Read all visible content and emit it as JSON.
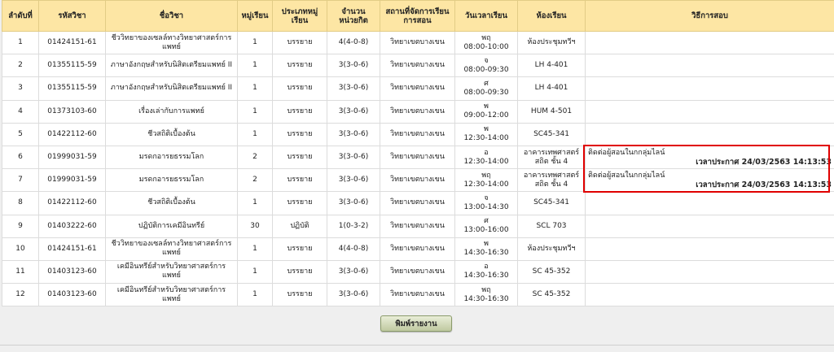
{
  "table": {
    "headers": [
      "ลำดับที่",
      "รหัสวิชา",
      "ชื่อวิชา",
      "หมู่เรียน",
      "ประเภทหมู่เรียน",
      "จำนวนหน่วยกิต",
      "สถานที่จัดการเรียนการสอน",
      "วันเวลาเรียน",
      "ห้องเรียน",
      "วิธีการสอบ"
    ],
    "rows": [
      {
        "no": "1",
        "code": "01424151-61",
        "name": "ชีววิทยาของเซลล์ทางวิทยาศาสตร์การแพทย์",
        "section": "1",
        "type": "บรรยาย",
        "credits": "4(4-0-8)",
        "campus": "วิทยาเขตบางเขน",
        "day": "พฤ",
        "time": "08:00-10:00",
        "room": "ห้องประชุมทวีฯ",
        "exam_note": "",
        "exam_time": ""
      },
      {
        "no": "2",
        "code": "01355115-59",
        "name": "ภาษาอังกฤษสำหรับนิสิตเตรียมแพทย์ II",
        "section": "1",
        "type": "บรรยาย",
        "credits": "3(3-0-6)",
        "campus": "วิทยาเขตบางเขน",
        "day": "จ",
        "time": "08:00-09:30",
        "room": "LH 4-401",
        "exam_note": "",
        "exam_time": ""
      },
      {
        "no": "3",
        "code": "01355115-59",
        "name": "ภาษาอังกฤษสำหรับนิสิตเตรียมแพทย์ II",
        "section": "1",
        "type": "บรรยาย",
        "credits": "3(3-0-6)",
        "campus": "วิทยาเขตบางเขน",
        "day": "ศ",
        "time": "08:00-09:30",
        "room": "LH 4-401",
        "exam_note": "",
        "exam_time": ""
      },
      {
        "no": "4",
        "code": "01373103-60",
        "name": "เรื่องเล่ากับการแพทย์",
        "section": "1",
        "type": "บรรยาย",
        "credits": "3(3-0-6)",
        "campus": "วิทยาเขตบางเขน",
        "day": "พ",
        "time": "09:00-12:00",
        "room": "HUM 4-501",
        "exam_note": "",
        "exam_time": ""
      },
      {
        "no": "5",
        "code": "01422112-60",
        "name": "ชีวสถิติเบื้องต้น",
        "section": "1",
        "type": "บรรยาย",
        "credits": "3(3-0-6)",
        "campus": "วิทยาเขตบางเขน",
        "day": "พ",
        "time": "12:30-14:00",
        "room": "SC45-341",
        "exam_note": "",
        "exam_time": ""
      },
      {
        "no": "6",
        "code": "01999031-59",
        "name": "มรดกอารยธรรมโลก",
        "section": "2",
        "type": "บรรยาย",
        "credits": "3(3-0-6)",
        "campus": "วิทยาเขตบางเขน",
        "day": "อ",
        "time": "12:30-14:00",
        "room": "อาคารเทพศาสตร์สถิต ชั้น 4",
        "exam_note": "ติดต่อผู้สอนในกกลุ่มไลน์",
        "exam_time": "เวลาประกาศ 24/03/2563 14:13:53"
      },
      {
        "no": "7",
        "code": "01999031-59",
        "name": "มรดกอารยธรรมโลก",
        "section": "2",
        "type": "บรรยาย",
        "credits": "3(3-0-6)",
        "campus": "วิทยาเขตบางเขน",
        "day": "พฤ",
        "time": "12:30-14:00",
        "room": "อาคารเทพศาสตร์สถิต ชั้น 4",
        "exam_note": "ติดต่อผู้สอนในกกลุ่มไลน์",
        "exam_time": "เวลาประกาศ 24/03/2563 14:13:53"
      },
      {
        "no": "8",
        "code": "01422112-60",
        "name": "ชีวสถิติเบื้องต้น",
        "section": "1",
        "type": "บรรยาย",
        "credits": "3(3-0-6)",
        "campus": "วิทยาเขตบางเขน",
        "day": "จ",
        "time": "13:00-14:30",
        "room": "SC45-341",
        "exam_note": "",
        "exam_time": ""
      },
      {
        "no": "9",
        "code": "01403222-60",
        "name": "ปฏิบัติการเคมีอินทรีย์",
        "section": "30",
        "type": "ปฏิบัติ",
        "credits": "1(0-3-2)",
        "campus": "วิทยาเขตบางเขน",
        "day": "ศ",
        "time": "13:00-16:00",
        "room": "SCL 703",
        "exam_note": "",
        "exam_time": ""
      },
      {
        "no": "10",
        "code": "01424151-61",
        "name": "ชีววิทยาของเซลล์ทางวิทยาศาสตร์การแพทย์",
        "section": "1",
        "type": "บรรยาย",
        "credits": "4(4-0-8)",
        "campus": "วิทยาเขตบางเขน",
        "day": "พ",
        "time": "14:30-16:30",
        "room": "ห้องประชุมทวีฯ",
        "exam_note": "",
        "exam_time": ""
      },
      {
        "no": "11",
        "code": "01403123-60",
        "name": "เคมีอินทรีย์สำหรับวิทยาศาสตร์การแพทย์",
        "section": "1",
        "type": "บรรยาย",
        "credits": "3(3-0-6)",
        "campus": "วิทยาเขตบางเขน",
        "day": "อ",
        "time": "14:30-16:30",
        "room": "SC 45-352",
        "exam_note": "",
        "exam_time": ""
      },
      {
        "no": "12",
        "code": "01403123-60",
        "name": "เคมีอินทรีย์สำหรับวิทยาศาสตร์การแพทย์",
        "section": "1",
        "type": "บรรยาย",
        "credits": "3(3-0-6)",
        "campus": "วิทยาเขตบางเขน",
        "day": "พฤ",
        "time": "14:30-16:30",
        "room": "SC 45-352",
        "exam_note": "",
        "exam_time": ""
      }
    ]
  },
  "print_button_label": "พิมพ์รายงาน",
  "colors": {
    "header_bg": "#fde6a4",
    "highlight_border": "#e00000",
    "button_bg": "#c9d2ad"
  }
}
